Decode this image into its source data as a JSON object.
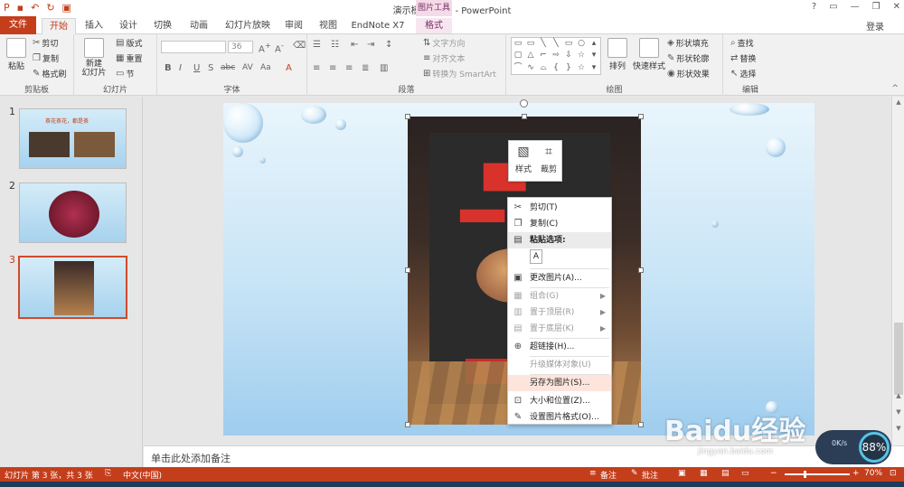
{
  "window": {
    "title": "演示模板.pptx - PowerPoint",
    "context_tool_banner": "图片工具",
    "controls": [
      "?",
      "▭",
      "—",
      "❐",
      "✕"
    ]
  },
  "tabs": [
    "文件",
    "开始",
    "插入",
    "设计",
    "切换",
    "动画",
    "幻灯片放映",
    "审阅",
    "视图",
    "EndNote X7",
    "格式"
  ],
  "active_tab": "开始",
  "login": "登录",
  "ribbon": {
    "clipboard": {
      "paste": "粘贴",
      "cut": "剪切",
      "copy": "复制",
      "format_painter": "格式刷",
      "label": "剪贴板"
    },
    "slides": {
      "new_slide": "新建\n幻灯片",
      "layout": "版式",
      "reset": "重置",
      "section": "节",
      "label": "幻灯片"
    },
    "font": {
      "font_size": "36",
      "label": "字体",
      "buttons": [
        "B",
        "I",
        "U",
        "S",
        "abc",
        "AV",
        "Aa",
        "A"
      ]
    },
    "paragraph": {
      "text_direction": "文字方向",
      "align_text": "对齐文本",
      "convert_smartart": "转换为 SmartArt",
      "label": "段落"
    },
    "drawing": {
      "arrange": "排列",
      "quick_styles": "快速样式",
      "shape_fill": "形状填充",
      "shape_outline": "形状轮廓",
      "shape_effects": "形状效果",
      "label": "绘图"
    },
    "editing": {
      "find": "查找",
      "replace": "替换",
      "select": "选择",
      "label": "编辑"
    }
  },
  "slides_pane": {
    "thumbnails": [
      {
        "num": "1",
        "title": "茶花茶花，都是茶"
      },
      {
        "num": "2"
      },
      {
        "num": "3"
      }
    ],
    "selected_index": 3
  },
  "mini_toolbar": {
    "style": "样式",
    "crop": "裁剪"
  },
  "context_menu": [
    {
      "label": "剪切(T)",
      "icon": "scissors-icon",
      "enabled": true
    },
    {
      "label": "复制(C)",
      "icon": "copy-icon",
      "enabled": true
    },
    {
      "label": "粘贴选项:",
      "icon": "paste-icon",
      "enabled": true,
      "header": true
    },
    {
      "label": "A",
      "icon": "paste-text-icon",
      "enabled": true,
      "paste_option": true
    },
    {
      "label": "更改图片(A)...",
      "icon": "change-picture-icon",
      "enabled": true
    },
    {
      "label": "组合(G)",
      "icon": "group-icon",
      "enabled": false,
      "submenu": true
    },
    {
      "label": "置于顶层(R)",
      "icon": "bring-front-icon",
      "enabled": false,
      "submenu": true
    },
    {
      "label": "置于底层(K)",
      "icon": "send-back-icon",
      "enabled": false,
      "submenu": true
    },
    {
      "label": "超链接(H)...",
      "icon": "hyperlink-icon",
      "enabled": true
    },
    {
      "label": "升级媒体对象(U)",
      "icon": "",
      "enabled": false
    },
    {
      "label": "另存为图片(S)...",
      "icon": "",
      "enabled": true,
      "highlighted": true
    },
    {
      "label": "大小和位置(Z)...",
      "icon": "size-position-icon",
      "enabled": true
    },
    {
      "label": "设置图片格式(O)...",
      "icon": "format-picture-icon",
      "enabled": true
    }
  ],
  "notes_placeholder": "单击此处添加备注",
  "statusbar": {
    "slide_info": "幻灯片 第 3 张，共 3 张",
    "language": "中文(中国)",
    "notes": "备注",
    "comments": "批注",
    "zoom": "70%",
    "zoom_level": 0.3
  },
  "overlays": {
    "speed": "0K/s",
    "percent": "88%",
    "watermark": "Baidu经验",
    "watermark_url": "jingyan.baidu.com"
  },
  "colors": {
    "accent": "#c43e1c",
    "context_tab": "#7a2e63"
  }
}
